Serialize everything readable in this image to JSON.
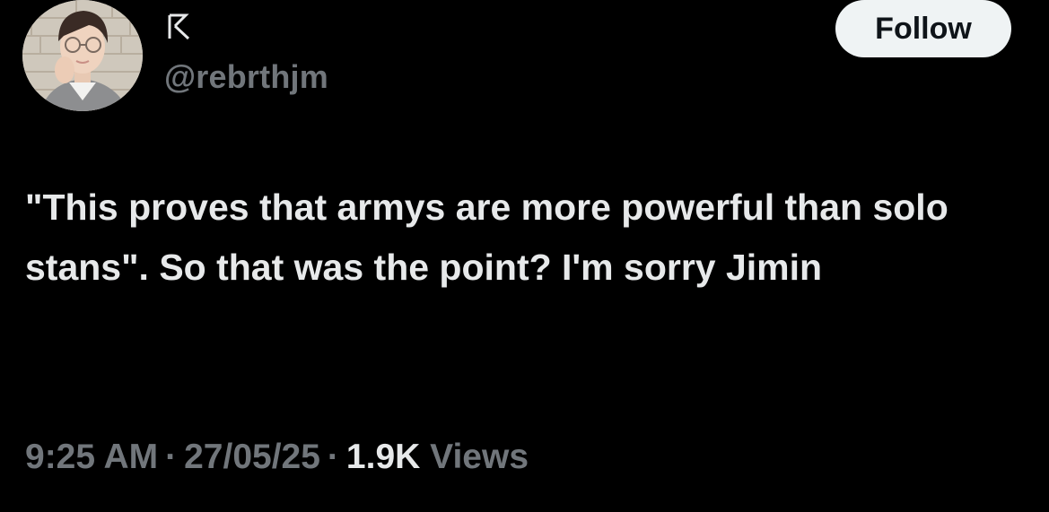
{
  "author": {
    "display_name_icon": "stylized-r-glyph",
    "handle": "@rebrthjm",
    "avatar": "profile-photo"
  },
  "actions": {
    "follow_label": "Follow"
  },
  "tweet": {
    "text": "\"This proves that armys are more powerful than solo stans\". So that was the point? I'm sorry Jimin"
  },
  "meta": {
    "time": "9:25 AM",
    "separator": "·",
    "date": "27/05/25",
    "views_count": "1.9K",
    "views_label": "Views"
  },
  "colors": {
    "background": "#000000",
    "text": "#e7e9ea",
    "secondary": "#71767b",
    "button_bg": "#eff3f4",
    "button_text": "#0f1419"
  }
}
